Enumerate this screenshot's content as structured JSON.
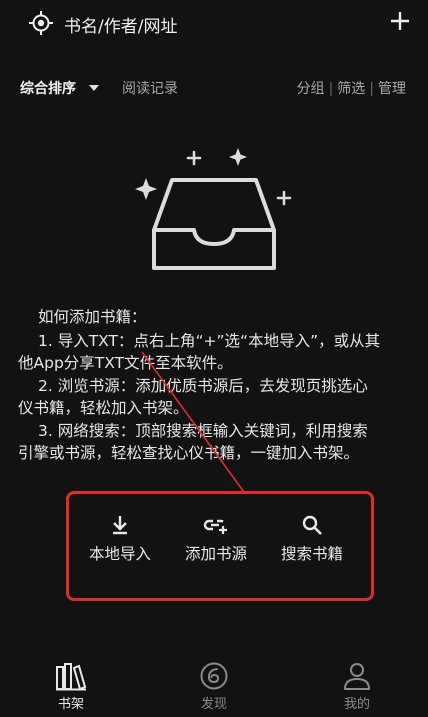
{
  "topbar": {
    "search_placeholder": "书名/作者/网址",
    "location_icon": "locate-icon",
    "add_icon": "plus-icon"
  },
  "filter": {
    "sort_label": "综合排序",
    "history_label": "阅读记录",
    "group_label": "分组",
    "filter_label": "筛选",
    "manage_label": "管理"
  },
  "help": {
    "title": "如何添加书籍：",
    "item1_a": "1. 导入TXT：点右上角“+”选“本地导入”，或从其",
    "item1_b": "他App分享TXT文件至本软件。",
    "item2_a": "2. 浏览书源：添加优质书源后，去发现页挑选心",
    "item2_b": "仪书籍，轻松加入书架。",
    "item3_a": "3. 网络搜索：顶部搜索框输入关键词，利用搜索",
    "item3_b": "引擎或书源，轻松查找心仪书籍，一键加入书架。"
  },
  "actions": [
    {
      "label": "本地导入",
      "icon": "download-icon"
    },
    {
      "label": "添加书源",
      "icon": "link-add-icon"
    },
    {
      "label": "搜索书籍",
      "icon": "search-icon"
    }
  ],
  "tabs": [
    {
      "label": "书架",
      "icon": "bookshelf-icon",
      "active": true
    },
    {
      "label": "发现",
      "icon": "discover-icon",
      "active": false
    },
    {
      "label": "我的",
      "icon": "profile-icon",
      "active": false
    }
  ],
  "colors": {
    "background": "#121212",
    "highlight_border": "#e12b2b",
    "inactive_tab": "#8a8a8a"
  }
}
